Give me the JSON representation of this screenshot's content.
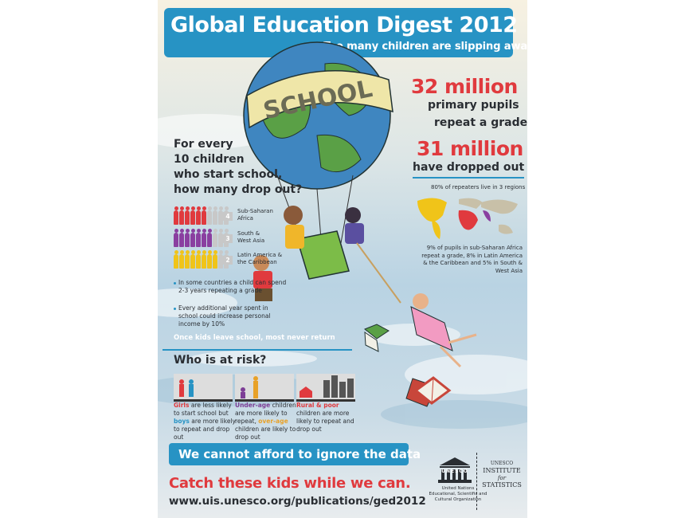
{
  "header": {
    "title": "Global Education Digest 2012",
    "subtitle": "Too many children are slipping away"
  },
  "balloon": {
    "label": "SCHOOL"
  },
  "stats": {
    "stat1_value": "32 million",
    "stat1_line1": "primary pupils",
    "stat1_line2": "repeat a grade",
    "stat2_value": "31 million",
    "stat2_text": "have dropped out"
  },
  "map": {
    "caption": "80% of repeaters live in 3 regions",
    "note_line1": "9% of pupils in sub-Saharan Africa",
    "note_line2": "repeat a grade, 8% in Latin America",
    "note_line3": "& the Caribbean and 5% in South &",
    "note_line4": "West Asia"
  },
  "dropout": {
    "question_line1": "For every",
    "question_line2": "10 children",
    "question_line3": "who start school,",
    "question_line4": "how many drop out?",
    "regions": [
      {
        "label_line1": "Sub-Saharan",
        "label_line2": "Africa",
        "dropouts": 4,
        "number": "4",
        "color": "#e03a3e"
      },
      {
        "label_line1": "South &",
        "label_line2": "West Asia",
        "dropouts": 3,
        "number": "3",
        "color": "#8a3fa0"
      },
      {
        "label_line1": "Latin America &",
        "label_line2": "the Caribbean",
        "dropouts": 2,
        "number": "2",
        "color": "#f0c419"
      }
    ],
    "bullet1_line1": "In some countries a child can spend",
    "bullet1_line2": "2-3 years repeating a grade",
    "bullet2_line1": "Every additional year spent in",
    "bullet2_line2": "school could increase personal",
    "bullet2_line3": "income by 10%",
    "footer": "Once kids leave school, most never return"
  },
  "risk": {
    "title": "Who is at risk?",
    "card1": {
      "w1": "Girls",
      "t1": " are less likely",
      "line2": "to start school but",
      "w3": "boys",
      "t3": " are more likely",
      "line4": "to repeat and drop",
      "line5": "out"
    },
    "card2": {
      "w1": "Under-age",
      "t1": " children",
      "line2": "are more likely to",
      "t3": "repeat, ",
      "w3": "over-age",
      "line4": "children are likely to",
      "line5": "drop out"
    },
    "card3": {
      "w1": "Rural & poor",
      "line2": "children are more",
      "line3": "likely to repeat and",
      "line4": "drop out"
    }
  },
  "footer": {
    "cta": "We cannot afford to ignore the data",
    "catch": "Catch these kids while we can.",
    "url": "www.uis.unesco.org/publications/ged2012",
    "unesco_word": "UNESCO",
    "org_line1": "United Nations",
    "org_line2": "Educational, Scientific and",
    "org_line3": "Cultural Organization",
    "uis_line1": "UNESCO",
    "uis_line2": "INSTITUTE",
    "uis_line3": "for",
    "uis_line4": "STATISTICS"
  },
  "colors": {
    "accent_blue": "#2793c4",
    "stat_red": "#e03a3e",
    "region_purple": "#8a3fa0",
    "region_yellow": "#f0c419"
  }
}
